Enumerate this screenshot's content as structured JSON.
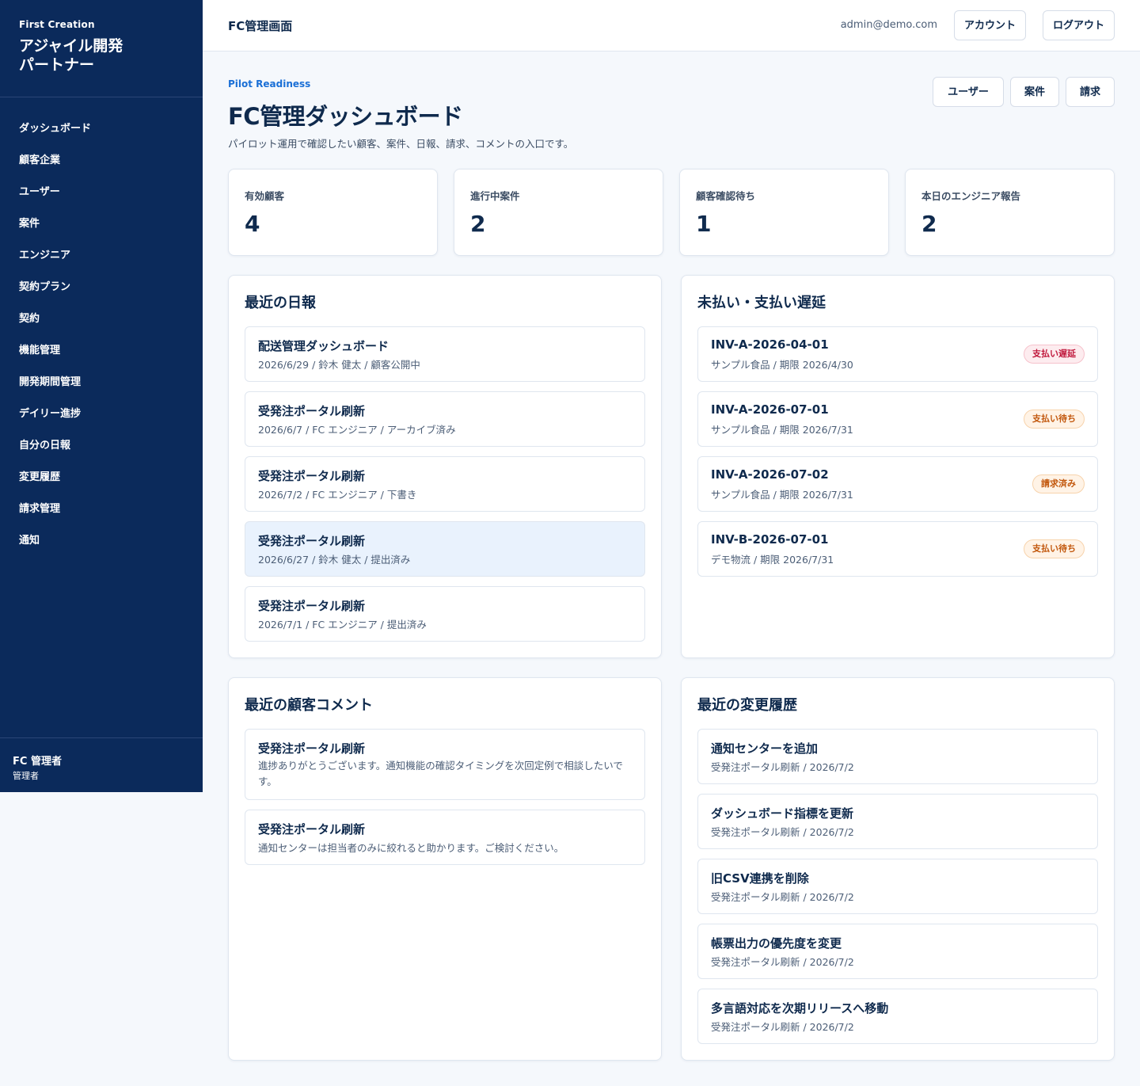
{
  "sidebar": {
    "brand_sub": "First Creation",
    "brand_title": "アジャイル開発\nパートナー",
    "items": [
      {
        "label": "ダッシュボード"
      },
      {
        "label": "顧客企業"
      },
      {
        "label": "ユーザー"
      },
      {
        "label": "案件"
      },
      {
        "label": "エンジニア"
      },
      {
        "label": "契約プラン"
      },
      {
        "label": "契約"
      },
      {
        "label": "機能管理"
      },
      {
        "label": "開発期間管理"
      },
      {
        "label": "デイリー進捗"
      },
      {
        "label": "自分の日報"
      },
      {
        "label": "変更履歴"
      },
      {
        "label": "請求管理"
      },
      {
        "label": "通知"
      }
    ],
    "footer_name": "FC 管理者",
    "footer_role": "管理者"
  },
  "topbar": {
    "title": "FC管理画面",
    "email": "admin@demo.com",
    "account_label": "アカウント",
    "logout_label": "ログアウト"
  },
  "header": {
    "eyebrow": "Pilot Readiness",
    "title": "FC管理ダッシュボード",
    "description": "パイロット運用で確認したい顧客、案件、日報、請求、コメントの入口です。",
    "quick_links": {
      "users": "ユーザー",
      "projects": "案件",
      "billing": "請求"
    }
  },
  "stats": [
    {
      "label": "有効顧客",
      "value": "4"
    },
    {
      "label": "進行中案件",
      "value": "2"
    },
    {
      "label": "顧客確認待ち",
      "value": "1"
    },
    {
      "label": "本日のエンジニア報告",
      "value": "2"
    }
  ],
  "reports": {
    "title": "最近の日報",
    "items": [
      {
        "title": "配送管理ダッシュボード",
        "meta": "2026/6/29 / 鈴木 健太 / 顧客公開中"
      },
      {
        "title": "受発注ポータル刷新",
        "meta": "2026/6/7 / FC エンジニア / アーカイブ済み"
      },
      {
        "title": "受発注ポータル刷新",
        "meta": "2026/7/2 / FC エンジニア / 下書き"
      },
      {
        "title": "受発注ポータル刷新",
        "meta": "2026/6/27 / 鈴木 健太 / 提出済み"
      },
      {
        "title": "受発注ポータル刷新",
        "meta": "2026/7/1 / FC エンジニア / 提出済み"
      }
    ]
  },
  "invoices": {
    "title": "未払い・支払い遅延",
    "items": [
      {
        "id": "INV-A-2026-04-01",
        "meta": "サンプル食品 / 期限 2026/4/30",
        "status": "支払い遅延",
        "status_color": "#c0183c"
      },
      {
        "id": "INV-A-2026-07-01",
        "meta": "サンプル食品 / 期限 2026/7/31",
        "status": "支払い待ち",
        "status_color": "#c2570c"
      },
      {
        "id": "INV-A-2026-07-02",
        "meta": "サンプル食品 / 期限 2026/7/31",
        "status": "請求済み",
        "status_color": "#c2570c"
      },
      {
        "id": "INV-B-2026-07-01",
        "meta": "デモ物流 / 期限 2026/7/31",
        "status": "支払い待ち",
        "status_color": "#c2570c"
      }
    ]
  },
  "comments": {
    "title": "最近の顧客コメント",
    "items": [
      {
        "title": "受発注ポータル刷新",
        "body": "進捗ありがとうございます。通知機能の確認タイミングを次回定例で相談したいです。"
      },
      {
        "title": "受発注ポータル刷新",
        "body": "通知センターは担当者のみに絞れると助かります。ご検討ください。"
      }
    ]
  },
  "changes": {
    "title": "最近の変更履歴",
    "items": [
      {
        "title": "通知センターを追加",
        "meta": "受発注ポータル刷新 / 2026/7/2"
      },
      {
        "title": "ダッシュボード指標を更新",
        "meta": "受発注ポータル刷新 / 2026/7/2"
      },
      {
        "title": "旧CSV連携を削除",
        "meta": "受発注ポータル刷新 / 2026/7/2"
      },
      {
        "title": "帳票出力の優先度を変更",
        "meta": "受発注ポータル刷新 / 2026/7/2"
      },
      {
        "title": "多言語対応を次期リリースへ移動",
        "meta": "受発注ポータル刷新 / 2026/7/2"
      }
    ]
  },
  "colors": {
    "sidebar": "#0b2a5b",
    "accent": "#1a6fd6",
    "selected_row": "#e9f2fd"
  }
}
